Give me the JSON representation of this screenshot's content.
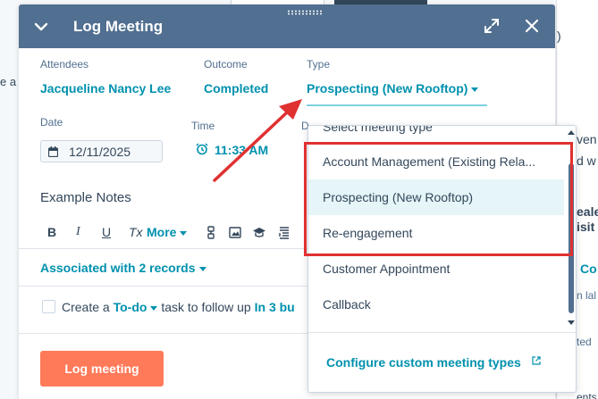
{
  "background": {
    "left_fragment": "e a",
    "right_fragments": [
      ")",
      "ven",
      "d w",
      "eale",
      "isit",
      "Co",
      "n lal",
      "ted",
      "ents"
    ]
  },
  "modal": {
    "title": "Log Meeting",
    "fields": {
      "attendees_label": "Attendees",
      "attendees_value": "Jacqueline Nancy Lee",
      "outcome_label": "Outcome",
      "outcome_value": "Completed",
      "type_label": "Type",
      "type_value": "Prospecting (New Rooftop)",
      "date_label": "Date",
      "date_value": "12/11/2025",
      "time_label": "Time",
      "time_value": "11:33 AM",
      "duration_label_partial": "D"
    },
    "notes_title": "Example Notes",
    "toolbar": {
      "bold": "B",
      "italic": "I",
      "underline": "U",
      "clear": "Tx",
      "more": "More"
    },
    "associated": "Associated with 2 records",
    "task": {
      "prefix": "Create a",
      "todo": "To-do",
      "middle": "task to follow up",
      "when": "In 3 bu"
    },
    "log_button": "Log meeting"
  },
  "dropdown": {
    "placeholder": "Select meeting type",
    "items": [
      "Account Management (Existing Rela...",
      "Prospecting (New Rooftop)",
      "Re-engagement",
      "Customer Appointment",
      "Callback"
    ],
    "selected_index": 1,
    "footer_link": "Configure custom meeting types"
  },
  "colors": {
    "header": "#516f90",
    "link": "#0091ae",
    "primary_button": "#ff7a59",
    "annotation": "#e03131"
  }
}
